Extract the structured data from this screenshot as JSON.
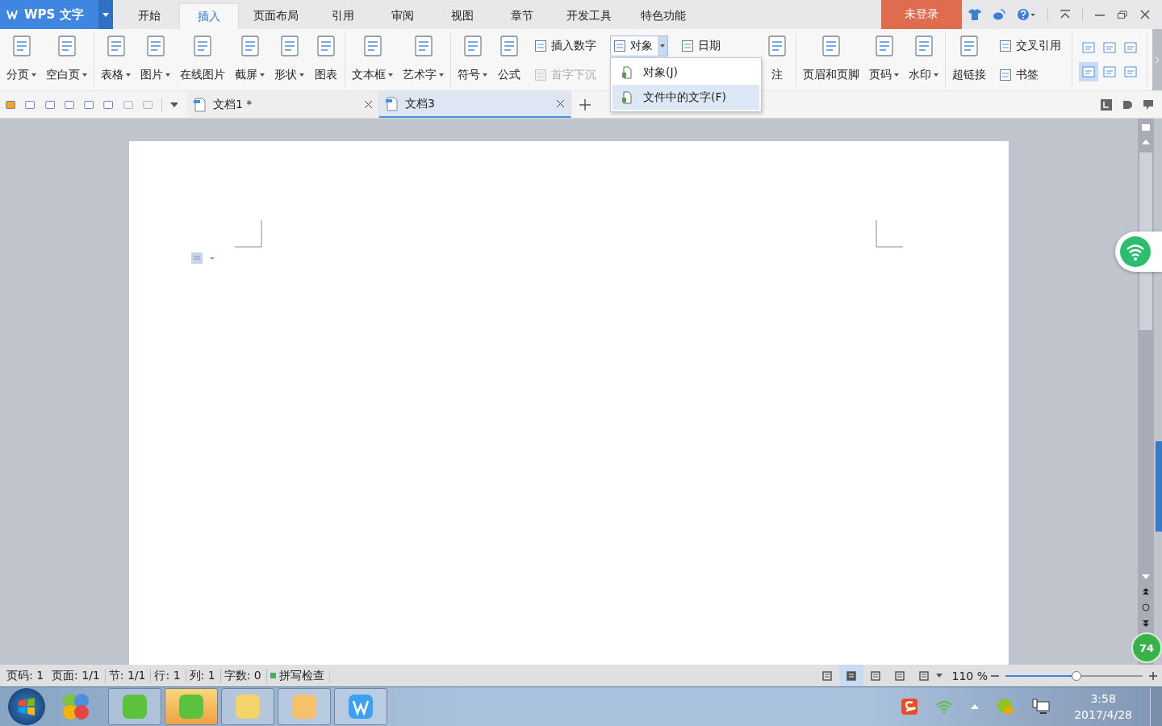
{
  "app": {
    "name": "WPS 文字"
  },
  "menu_tabs": [
    {
      "label": "开始",
      "selected": false
    },
    {
      "label": "插入",
      "selected": true
    },
    {
      "label": "页面布局",
      "selected": false
    },
    {
      "label": "引用",
      "selected": false
    },
    {
      "label": "审阅",
      "selected": false
    },
    {
      "label": "视图",
      "selected": false
    },
    {
      "label": "章节",
      "selected": false
    },
    {
      "label": "开发工具",
      "selected": false
    },
    {
      "label": "特色功能",
      "selected": false
    }
  ],
  "login_button": "未登录",
  "ribbon_groups": [
    {
      "items": [
        {
          "kind": "large",
          "label": "分页",
          "dropdown": true
        },
        {
          "kind": "large",
          "label": "空白页",
          "dropdown": true
        }
      ]
    },
    {
      "items": [
        {
          "kind": "large",
          "label": "表格",
          "dropdown": true
        },
        {
          "kind": "large",
          "label": "图片",
          "dropdown": true
        },
        {
          "kind": "large",
          "label": "在线图片",
          "dropdown": false
        },
        {
          "kind": "large",
          "label": "截屏",
          "dropdown": true
        },
        {
          "kind": "large",
          "label": "形状",
          "dropdown": true
        },
        {
          "kind": "large",
          "label": "图表",
          "dropdown": false
        }
      ]
    },
    {
      "items": [
        {
          "kind": "large",
          "label": "文本框",
          "dropdown": true
        },
        {
          "kind": "large",
          "label": "艺术字",
          "dropdown": true
        }
      ]
    },
    {
      "items": [
        {
          "kind": "large",
          "label": "符号",
          "dropdown": true
        },
        {
          "kind": "large",
          "label": "公式",
          "dropdown": false
        },
        {
          "kind": "stack",
          "rows": [
            {
              "label": "插入数字",
              "disabled": false
            },
            {
              "label": "首字下沉",
              "disabled": true
            }
          ]
        },
        {
          "kind": "stack",
          "rows": [
            {
              "label": "对象",
              "disabled": false,
              "menu": {
                "items": [
                  {
                    "label": "对象(J)",
                    "selected": false
                  },
                  {
                    "label": "文件中的文字(F)",
                    "selected": true
                  }
                ]
              }
            }
          ]
        },
        {
          "kind": "stack",
          "rows": [
            {
              "label": "日期",
              "disabled": false
            }
          ]
        },
        {
          "kind": "large",
          "label": "注",
          "dropdown": false
        }
      ]
    },
    {
      "items": [
        {
          "kind": "large",
          "label": "页眉和页脚",
          "dropdown": false
        },
        {
          "kind": "large",
          "label": "页码",
          "dropdown": true
        },
        {
          "kind": "large",
          "label": "水印",
          "dropdown": true
        }
      ]
    },
    {
      "items": [
        {
          "kind": "large",
          "label": "超链接",
          "dropdown": false
        },
        {
          "kind": "stack",
          "rows": [
            {
              "label": "交叉引用",
              "disabled": false
            },
            {
              "label": "书签",
              "disabled": false
            }
          ]
        }
      ]
    },
    {
      "items": [
        {
          "kind": "grid"
        }
      ]
    }
  ],
  "doc_tabs": [
    {
      "label": "文档1 *",
      "selected": false
    },
    {
      "label": "文档3",
      "selected": true
    }
  ],
  "status_bar": {
    "items": [
      "页码: 1",
      "页面: 1/1",
      "节: 1/1",
      "行: 1",
      "列: 1",
      "字数: 0"
    ],
    "spell_check": "拼写检查",
    "view_modes": [
      {
        "selected": false
      },
      {
        "selected": true
      },
      {
        "selected": false
      },
      {
        "selected": false
      },
      {
        "selected": false
      }
    ],
    "zoom": "110 %",
    "zoom_slider": {
      "level": 0.52
    }
  },
  "taskbar": {
    "time": "3:58",
    "date": "2017/4/28"
  },
  "float_badge": "74"
}
